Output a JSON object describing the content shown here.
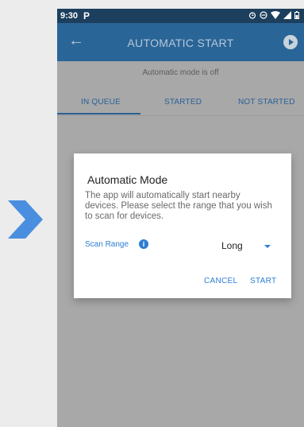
{
  "status_bar": {
    "time": "9:30",
    "app_icon": "P",
    "icons": [
      "alarm-icon",
      "do-not-disturb-icon",
      "wifi-icon",
      "signal-icon",
      "battery-icon"
    ]
  },
  "app_bar": {
    "back_icon": "arrow-left-icon",
    "title": "AUTOMATIC START",
    "action_icon": "play-icon"
  },
  "mode_status": "Automatic mode is off",
  "tabs": [
    {
      "label": "IN QUEUE",
      "selected": true
    },
    {
      "label": "STARTED",
      "selected": false
    },
    {
      "label": "NOT STARTED",
      "selected": false
    }
  ],
  "dialog": {
    "title": "Automatic Mode",
    "message": "The app will automatically start nearby devices. Please select the range that you wish to scan for devices.",
    "scan_range_label": "Scan Range",
    "info_glyph": "i",
    "scan_range_value": "Long",
    "cancel_label": "CANCEL",
    "start_label": "START"
  },
  "colors": {
    "accent": "#2d7dd2",
    "app_bar": "#2a6597",
    "status_bar": "#1c3f5d",
    "chevron": "#4a8ee0"
  }
}
